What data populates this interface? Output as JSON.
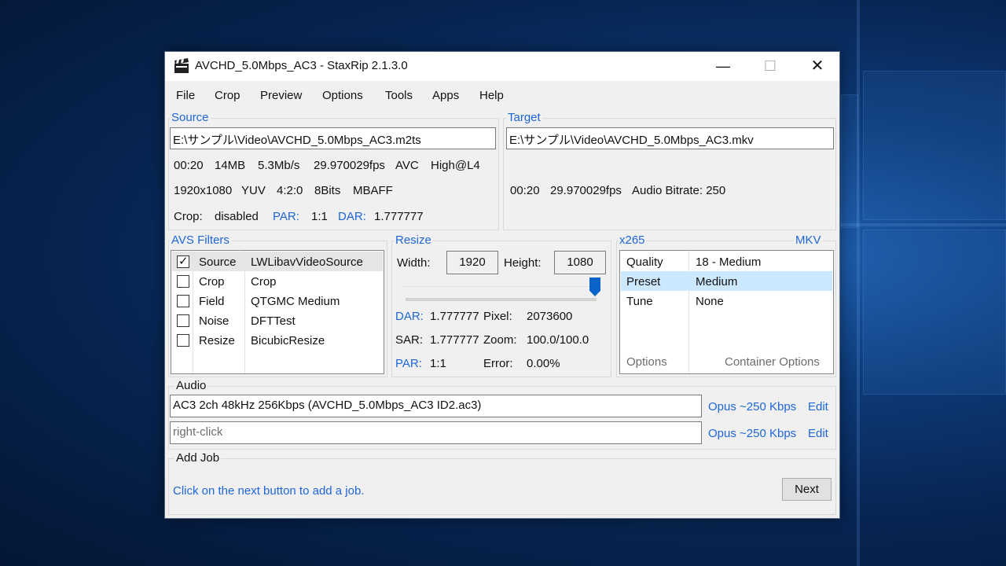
{
  "window": {
    "title": "AVCHD_5.0Mbps_AC3 - StaxRip 2.1.3.0",
    "minimize": "—",
    "maximize": "☐",
    "close": "✕"
  },
  "menu": [
    "File",
    "Crop",
    "Preview",
    "Options",
    "Tools",
    "Apps",
    "Help"
  ],
  "source": {
    "label": "Source",
    "path": "E:\\サンプル\\Video\\AVCHD_5.0Mbps_AC3.m2ts",
    "line1": [
      "00:20",
      "14MB",
      "5.3Mb/s",
      "29.970029fps",
      "AVC",
      "High@L4"
    ],
    "line2": [
      "1920x1080",
      "YUV",
      "4:2:0",
      "8Bits",
      "MBAFF"
    ],
    "crop_label": "Crop:",
    "crop_value": "disabled",
    "par_label": "PAR:",
    "par_value": "1:1",
    "dar_label": "DAR:",
    "dar_value": "1.777777"
  },
  "target": {
    "label": "Target",
    "path": "E:\\サンプル\\Video\\AVCHD_5.0Mbps_AC3.mkv",
    "line": [
      "00:20",
      "29.970029fps",
      "Audio Bitrate: 250"
    ]
  },
  "filters": {
    "label": "AVS Filters",
    "rows": [
      {
        "category": "Source",
        "name": "LWLibavVideoSource",
        "checked": true
      },
      {
        "category": "Crop",
        "name": "Crop",
        "checked": false
      },
      {
        "category": "Field",
        "name": "QTGMC Medium",
        "checked": false
      },
      {
        "category": "Noise",
        "name": "DFTTest",
        "checked": false
      },
      {
        "category": "Resize",
        "name": "BicubicResize",
        "checked": false
      }
    ],
    "check_mark": "✓"
  },
  "resize": {
    "label": "Resize",
    "width_label": "Width:",
    "width_value": "1920",
    "height_label": "Height:",
    "height_value": "1080",
    "slider_level": 1.0,
    "dar_label": "DAR:",
    "dar_value": "1.777777",
    "pixel_label": "Pixel:",
    "pixel_value": "2073600",
    "sar_label": "SAR:",
    "sar_value": "1.777777",
    "zoom_label": "Zoom:",
    "zoom_value": "100.0/100.0",
    "par_label": "PAR:",
    "par_value": "1:1",
    "error_label": "Error:",
    "error_value": "0.00%"
  },
  "encoder": {
    "label": "x265",
    "container": "MKV",
    "rows": [
      {
        "key": "Quality",
        "value": "18 - Medium",
        "selected": false
      },
      {
        "key": "Preset",
        "value": "Medium",
        "selected": true
      },
      {
        "key": "Tune",
        "value": "None",
        "selected": false
      }
    ],
    "options_link": "Options",
    "container_options_link": "Container Options"
  },
  "audio": {
    "label": "Audio",
    "tracks": [
      {
        "value": "AC3 2ch 48kHz 256Kbps (AVCHD_5.0Mbps_AC3 ID2.ac3)",
        "codec": "Opus ~250 Kbps",
        "edit": "Edit"
      },
      {
        "value": "right-click",
        "codec": "Opus ~250 Kbps",
        "edit": "Edit"
      }
    ]
  },
  "add_job": {
    "label": "Add Job",
    "hint": "Click on the next button to add a job.",
    "next_label": "Next"
  },
  "colors": {
    "accent": "#1e66d8",
    "selection": "#cce8ff",
    "thumb": "#0a63c9"
  }
}
